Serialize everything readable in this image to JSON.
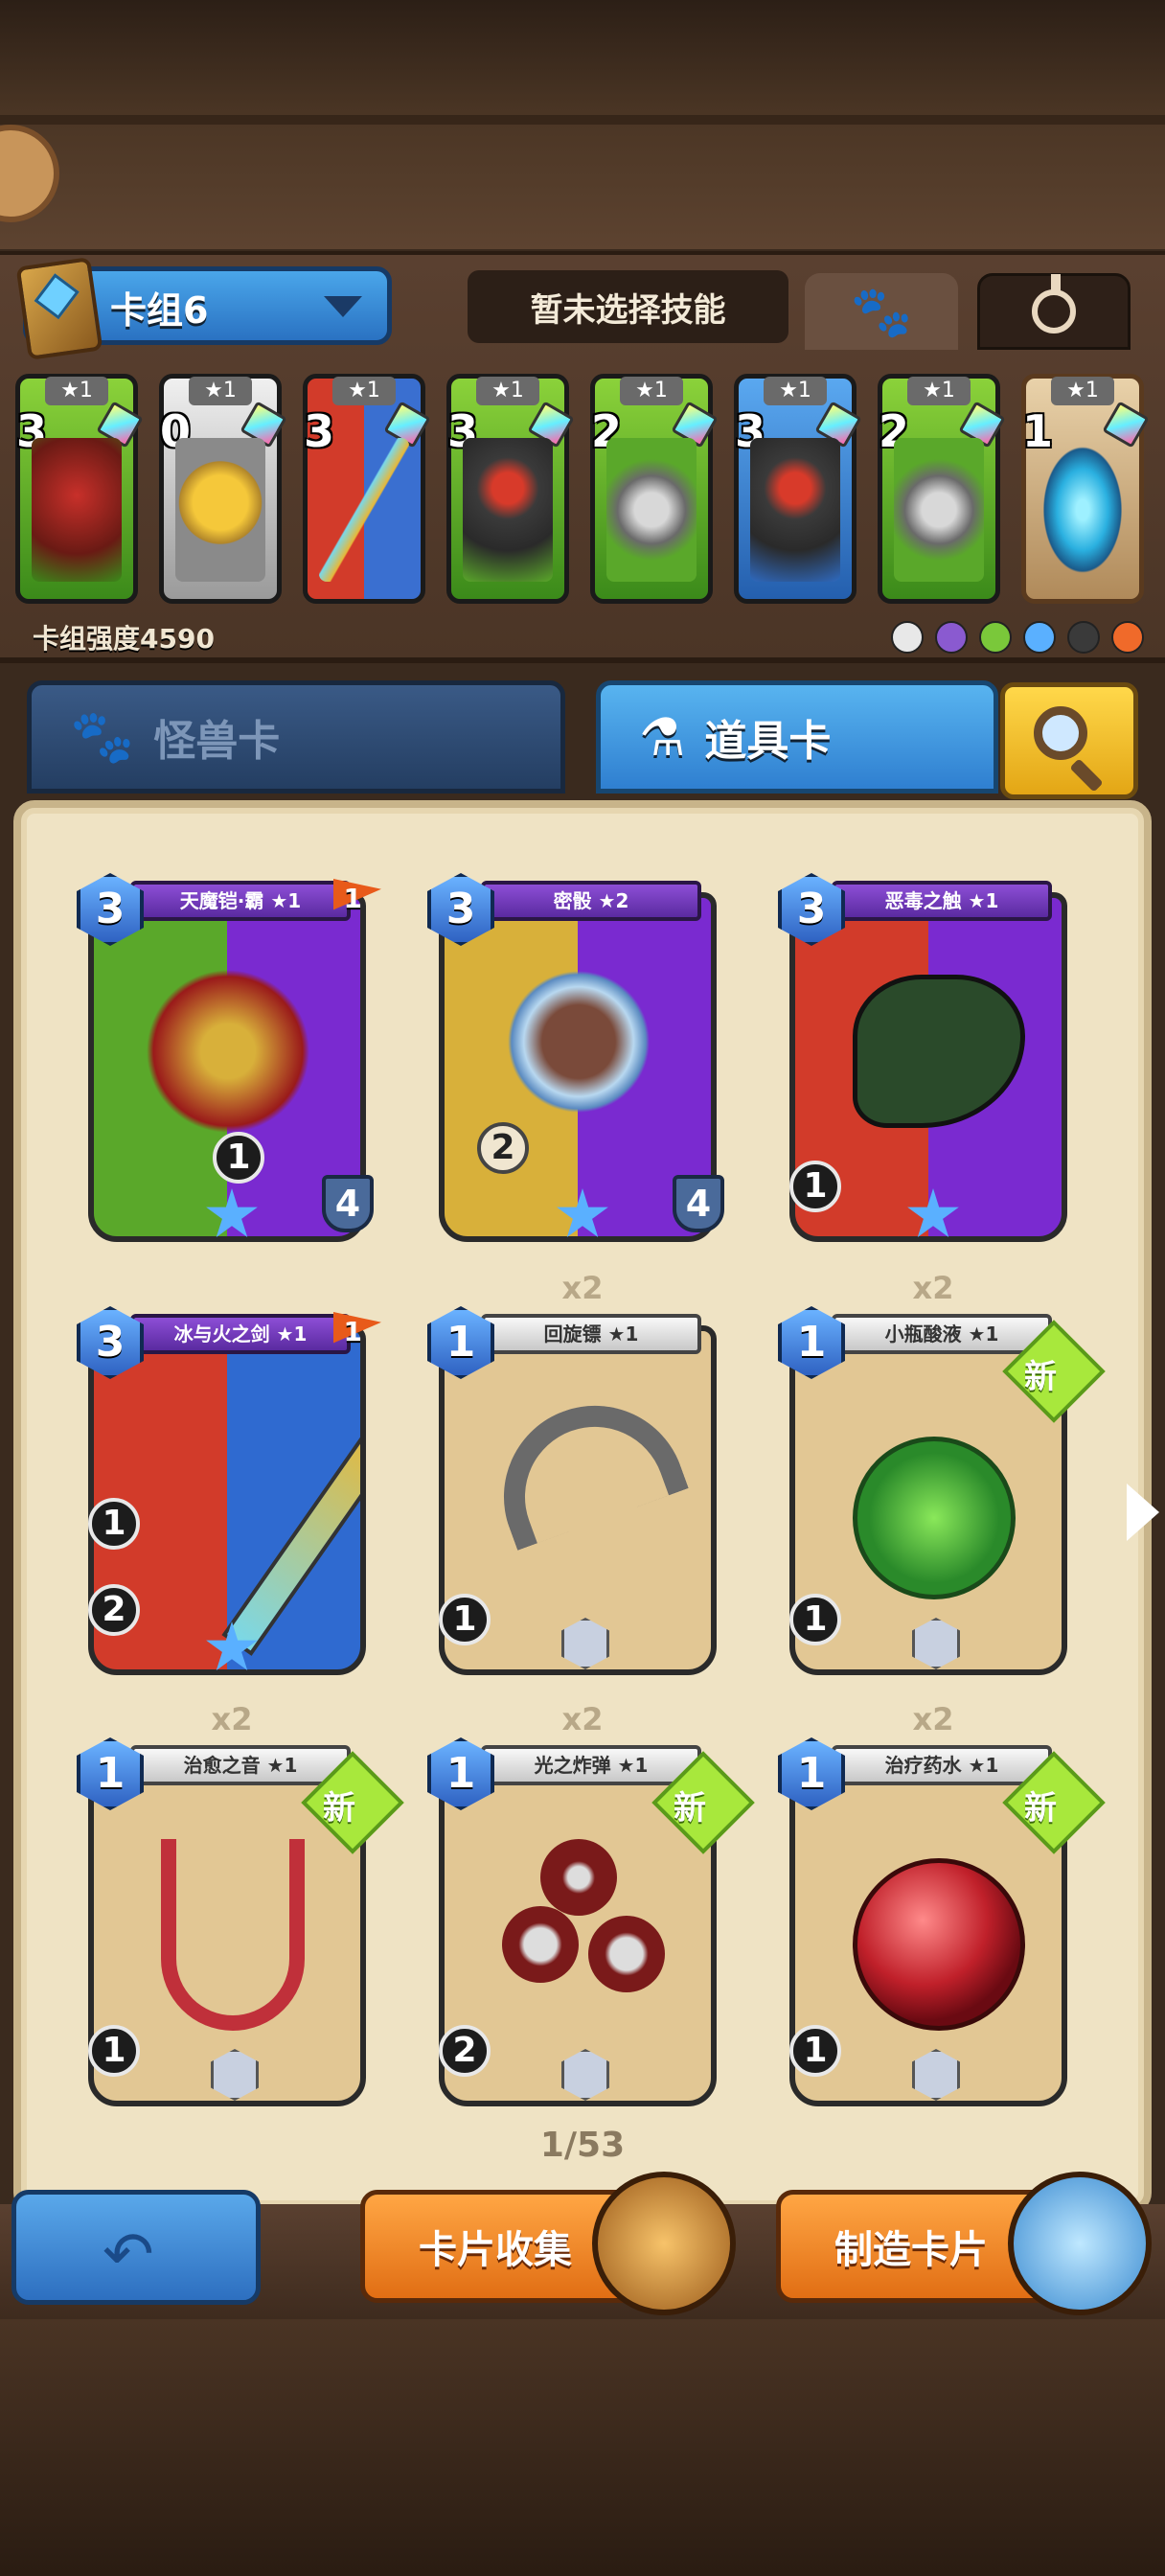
{
  "deck": {
    "name": "卡组6",
    "skill_label": "暂未选择技能",
    "power_label": "卡组强度4590",
    "mini_cards": [
      {
        "star": "★1",
        "cost": "3",
        "color": "green"
      },
      {
        "star": "★1",
        "cost": "0",
        "color": "gray"
      },
      {
        "star": "★1",
        "cost": "3",
        "color": "red"
      },
      {
        "star": "★1",
        "cost": "3",
        "color": "green"
      },
      {
        "star": "★1",
        "cost": "2",
        "color": "green"
      },
      {
        "star": "★1",
        "cost": "3",
        "color": "blue"
      },
      {
        "star": "★1",
        "cost": "2",
        "color": "green"
      },
      {
        "star": "★1",
        "cost": "1",
        "color": "tan"
      }
    ],
    "element_icons": [
      "#e8e8e8",
      "#8a5ad0",
      "#7ac83a",
      "#5ab0ff",
      "#3a3a3a",
      "#f06a2a"
    ]
  },
  "tabs": {
    "monster": "怪兽卡",
    "item": "道具卡",
    "monster_icon": "paw-icon",
    "item_icon": "potion-icon",
    "search_icon": "magnifier-icon"
  },
  "cards": [
    {
      "name": "天魔铠·霸 ★1",
      "cost": "3",
      "flag": "1",
      "stat_a": "1",
      "shield": "4",
      "style": "purple-green"
    },
    {
      "name": "密骰 ★2",
      "cost": "3",
      "stat_a": "2",
      "shield": "4",
      "style": "purple-yellow"
    },
    {
      "name": "恶毒之触 ★1",
      "cost": "3",
      "stat_a": "1",
      "style": "red-purple"
    },
    {
      "name": "冰与火之剑 ★1",
      "cost": "3",
      "flag": "1",
      "stat_a": "1",
      "stat_b": "2",
      "style": "red-blue"
    },
    {
      "name": "回旋镖 ★1",
      "cost": "1",
      "count": "x2",
      "stat_a": "1",
      "style": "parchment"
    },
    {
      "name": "小瓶酸液 ★1",
      "cost": "1",
      "count": "x2",
      "stat_a": "1",
      "new": "新",
      "style": "parchment"
    },
    {
      "name": "治愈之音 ★1",
      "cost": "1",
      "count": "x2",
      "stat_a": "1",
      "new": "新",
      "style": "parchment"
    },
    {
      "name": "光之炸弹 ★1",
      "cost": "1",
      "count": "x2",
      "stat_a": "2",
      "new": "新",
      "style": "parchment"
    },
    {
      "name": "治疗药水 ★1",
      "cost": "1",
      "count": "x2",
      "stat_a": "1",
      "new": "新",
      "style": "parchment"
    }
  ],
  "pagination": "1/53",
  "buttons": {
    "back_icon": "back-arrow-icon",
    "collect": "卡片收集",
    "craft": "制造卡片"
  }
}
